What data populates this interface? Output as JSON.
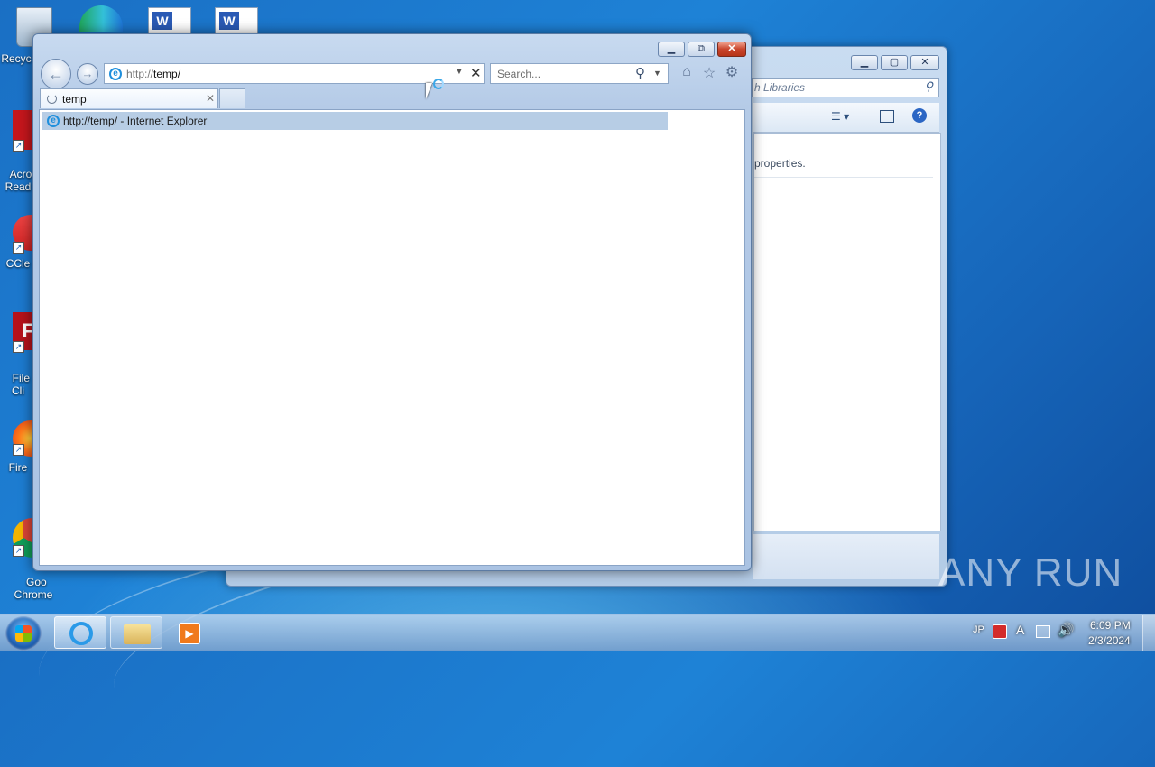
{
  "desktop": {
    "icons": [
      {
        "label": "Recyc",
        "icon": "recycle-bin-icon"
      },
      {
        "label": "Acro\nRead",
        "icon": "acrobat-reader-icon"
      },
      {
        "label": "CCle",
        "icon": "ccleaner-icon"
      },
      {
        "label": "File\nCli",
        "icon": "filezilla-icon"
      },
      {
        "label": "Fire",
        "icon": "firefox-icon"
      },
      {
        "label": "Goo\nChrome",
        "icon": "chrome-icon"
      }
    ]
  },
  "explorer": {
    "search_placeholder": "h Libraries",
    "properties_text": "properties."
  },
  "ie": {
    "address_prefix": "http://",
    "address_host": "temp/",
    "search_placeholder": "Search...",
    "tab_title": "temp",
    "suggestion": "http://temp/ - Internet Explorer"
  },
  "taskbar": {
    "tray": {
      "language": "JP",
      "ime": "A",
      "time": "6:09 PM",
      "date": "2/3/2024"
    }
  },
  "watermark": "ANY RUN",
  "colors": {
    "desktop": "#1e82d6",
    "close_button": "#c9452c",
    "suggestion_highlight": "#b7cde5"
  }
}
